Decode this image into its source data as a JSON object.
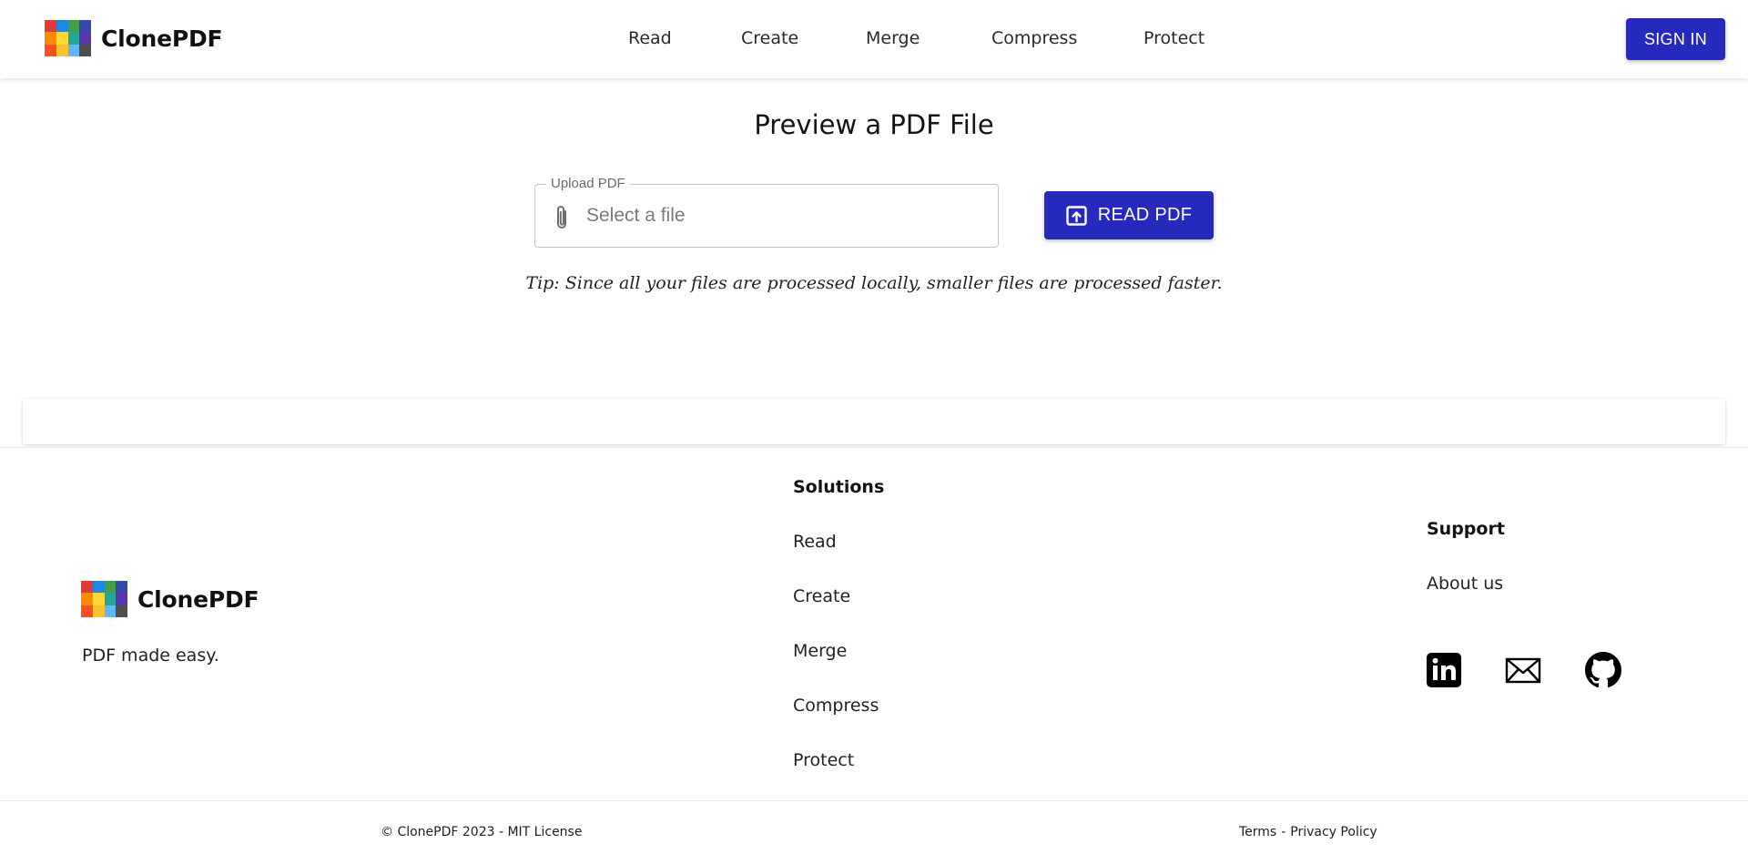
{
  "brand": {
    "name": "ClonePDF",
    "tagline": "PDF made easy.",
    "logo_colors": [
      "#e53935",
      "#1e88e5",
      "#43a047",
      "#3949ab",
      "#fb8c00",
      "#fdd835",
      "#26a69a",
      "#5e35b1",
      "#f4511e",
      "#fbc02d",
      "#64b5f6",
      "#4e4e4e"
    ]
  },
  "colors": {
    "accent": "#2629be"
  },
  "header": {
    "nav": [
      "Read",
      "Create",
      "Merge",
      "Compress",
      "Protect"
    ],
    "sign_in": "SIGN IN"
  },
  "main": {
    "title": "Preview a PDF File",
    "upload": {
      "legend": "Upload PDF",
      "placeholder": "Select a file",
      "icon": "paperclip-icon"
    },
    "read_button": {
      "label": "READ PDF",
      "icon": "upload-icon"
    },
    "tip": "Tip: Since all your files are processed locally, smaller files are processed faster."
  },
  "footer": {
    "solutions": {
      "title": "Solutions",
      "links": [
        "Read",
        "Create",
        "Merge",
        "Compress",
        "Protect"
      ]
    },
    "support": {
      "title": "Support",
      "links": [
        "About us"
      ]
    },
    "social": [
      "linkedin-icon",
      "mail-icon",
      "github-icon"
    ],
    "copyright": "© ClonePDF 2023 - MIT License",
    "legal": {
      "terms": "Terms",
      "separator": "-",
      "privacy": "Privacy Policy"
    }
  }
}
